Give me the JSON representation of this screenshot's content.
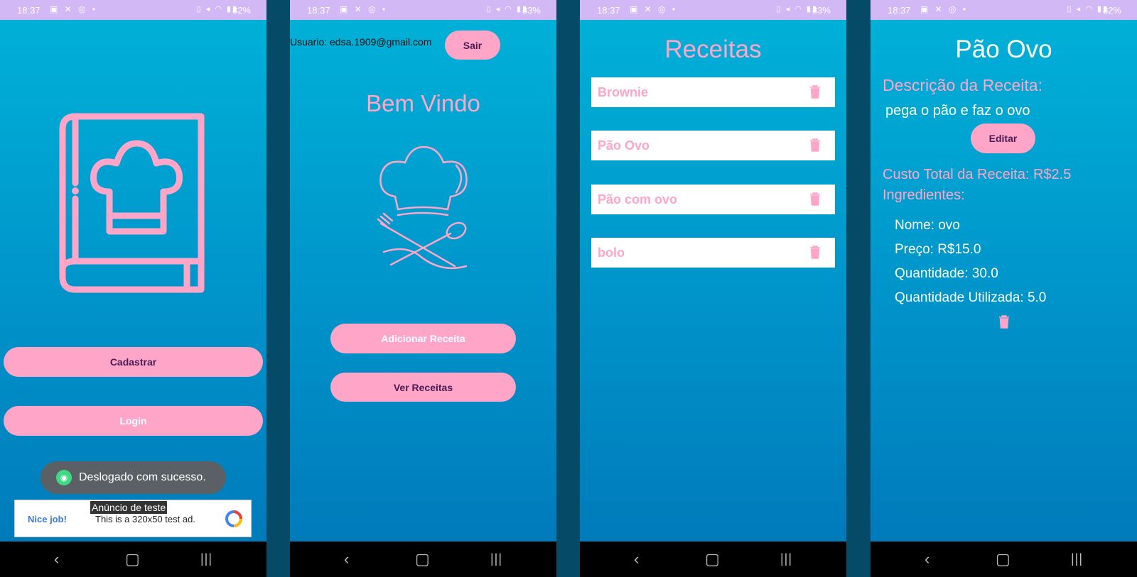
{
  "status_bar": {
    "screen1": {
      "time": "18:37",
      "battery": "82%"
    },
    "screen2": {
      "time": "18:37",
      "battery": "83%"
    },
    "screen3": {
      "time": "18:37",
      "battery": "83%"
    },
    "screen4": {
      "time": "18:37",
      "battery": "82%"
    }
  },
  "screen1": {
    "register_button": "Cadastrar",
    "login_button": "Login",
    "toast": "Deslogado com sucesso.",
    "ad": {
      "label": "Anúncio de teste",
      "headline": "Nice job!",
      "body": "This is a 320x50 test ad."
    }
  },
  "screen2": {
    "user_label": "Usuario: edsa.1909@gmail.com",
    "logout_button": "Sair",
    "welcome_title": "Bem Vindo",
    "add_recipe_button": "Adicionar Receita",
    "view_recipes_button": "Ver Receitas"
  },
  "screen3": {
    "title": "Receitas",
    "recipes": [
      "Brownie",
      "Pão Ovo",
      "Pão com ovo",
      "bolo"
    ]
  },
  "screen4": {
    "title": "Pão Ovo",
    "description_label": "Descrição da Receita:",
    "description": "pega o pão e faz o ovo",
    "edit_button": "Editar",
    "total_cost": "Custo Total da Receita: R$2.5",
    "ingredients_label": "Ingredientes:",
    "ingredient": {
      "name": "Nome: ovo",
      "price": "Preço: R$15.0",
      "quantity": "Quantidade: 30.0",
      "used": "Quantidade Utilizada: 5.0"
    }
  },
  "colors": {
    "accent_pink": "#ffa5c7",
    "button_text_dark": "#4a1c55",
    "status_bar": "#d2b8f5",
    "background_top": "#00b2d8",
    "background_bottom": "#0077b8"
  },
  "icons": [
    "recipe-book-icon",
    "chef-hat-utensils-icon",
    "trash-icon",
    "back-icon",
    "home-icon",
    "recent-apps-icon",
    "android-icon",
    "ad-logo-icon"
  ]
}
